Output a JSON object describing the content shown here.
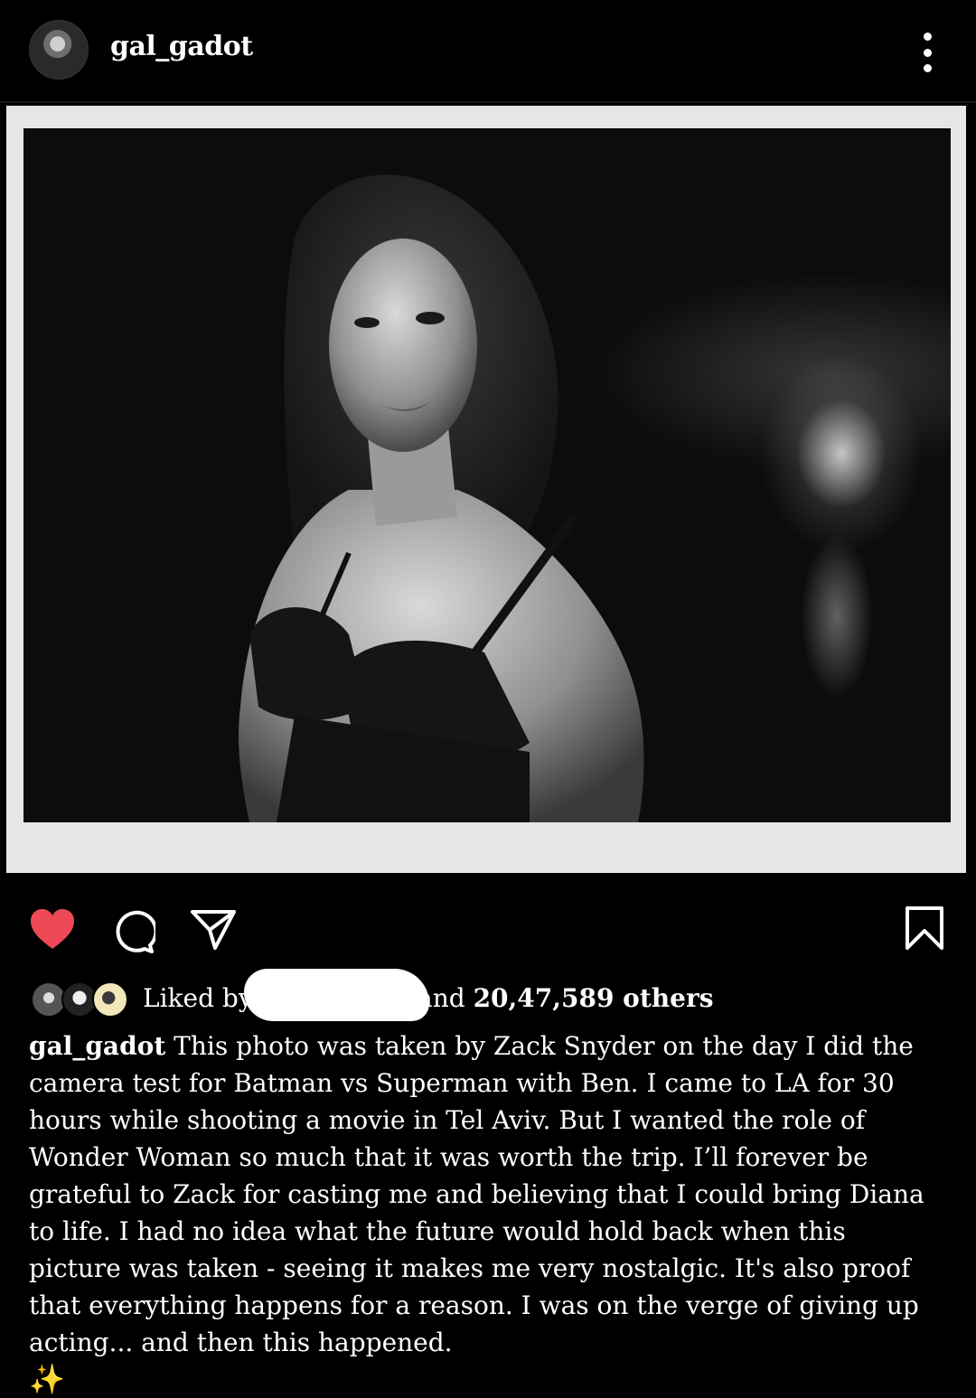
{
  "header": {
    "username": "gal_gadot"
  },
  "actions": {
    "heart_color": "#ed4956"
  },
  "likes": {
    "prefix": "Liked by",
    "suffix_pre": "and",
    "count": "20,47,589 others"
  },
  "caption": {
    "username": "gal_gadot",
    "text": "This photo was taken by Zack Snyder on the day I did the camera test for Batman vs Superman with Ben.  I came to LA for 30 hours while shooting a movie in Tel Aviv. But I wanted the role of Wonder Woman so much that it was worth the trip. I’ll forever be grateful to Zack for casting me and believing that I could bring Diana to life. I had no idea what the future would hold back when this picture was taken - seeing it makes me very nostalgic. It's also proof that everything happens for a reason. I was on the verge of giving up acting... and then this happened.",
    "emoji": "✨"
  },
  "icons": [
    "avatar",
    "more-icon",
    "heart-icon",
    "comment-icon",
    "share-icon",
    "save-icon"
  ]
}
